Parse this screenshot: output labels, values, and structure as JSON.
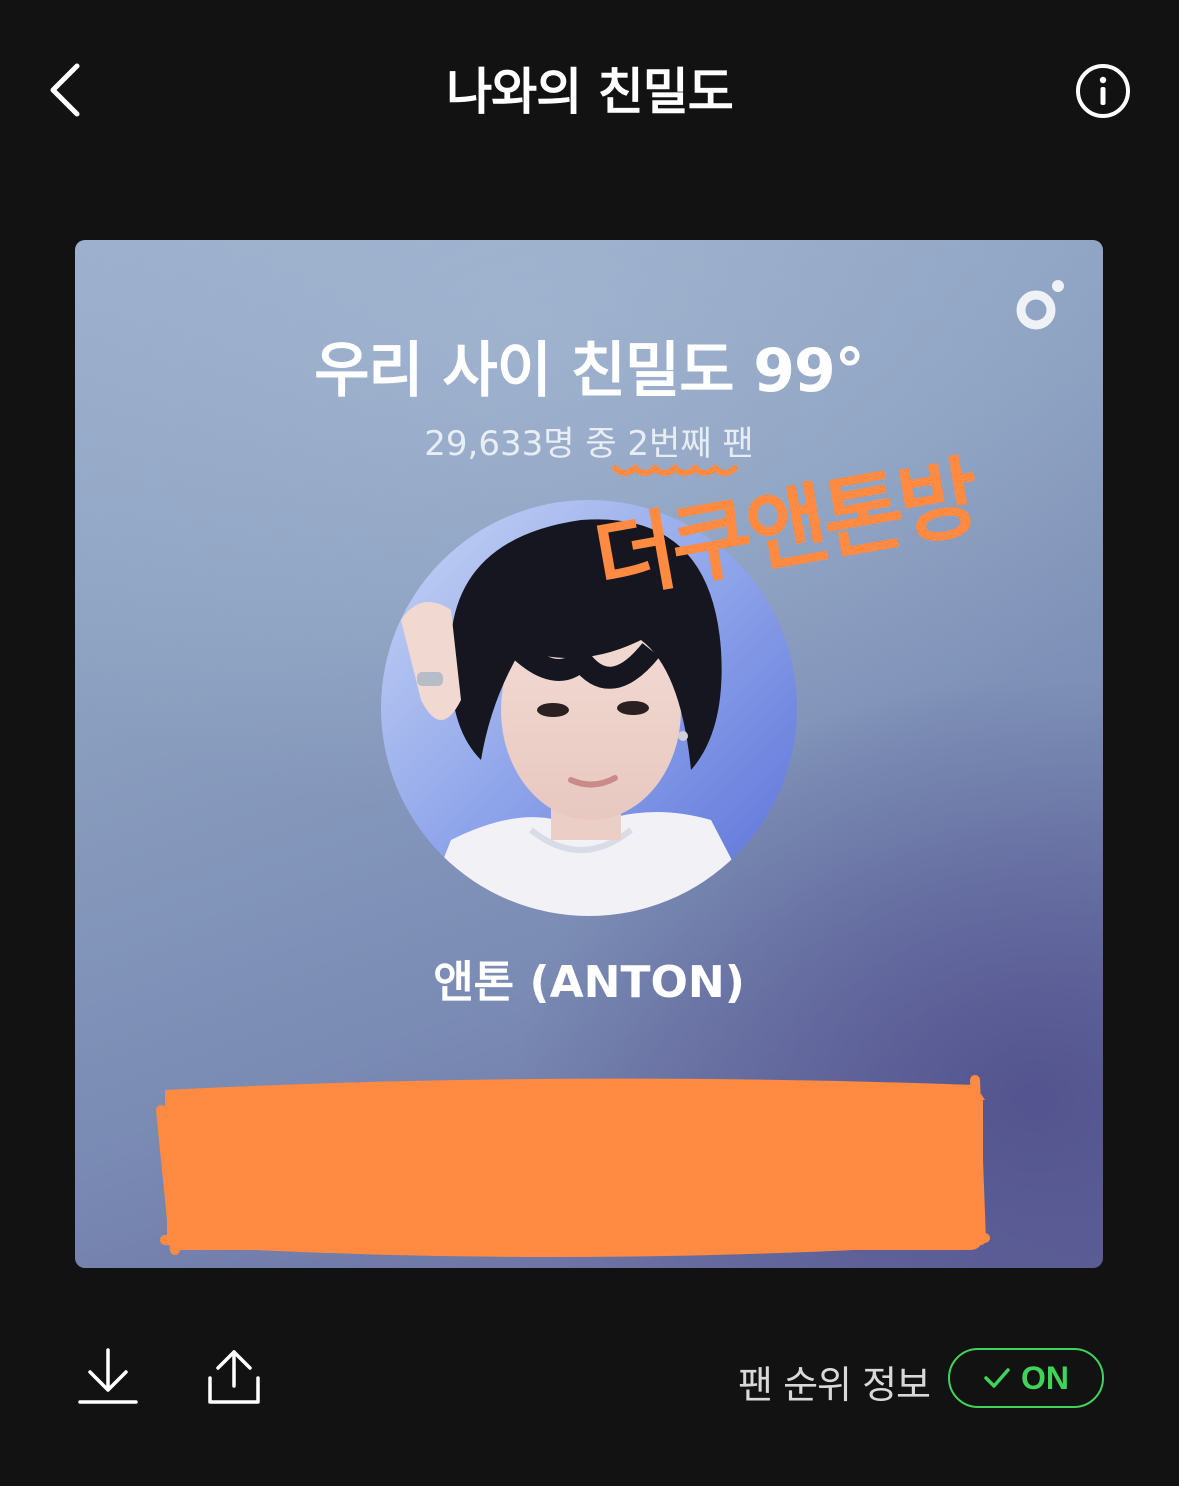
{
  "header": {
    "title": "나와의 친밀도",
    "back_icon": "chevron-left-icon",
    "info_icon": "info-icon"
  },
  "card": {
    "intimacy_title": "우리 사이 친밀도 99°",
    "fan_rank_text": "29,633명 중 2번째 팬",
    "artist_name": "앤톤 (ANTON)",
    "annotation": "더쿠앤톤방",
    "logo_icon": "brand-logo-icon",
    "colors": {
      "annotation": "#ff8a42",
      "redaction": "#ff8a42"
    }
  },
  "footer": {
    "download_icon": "download-icon",
    "share_icon": "share-icon",
    "fan_rank_info_label": "팬 순위 정보",
    "toggle_label": "ON",
    "toggle_color": "#3fd35a"
  }
}
